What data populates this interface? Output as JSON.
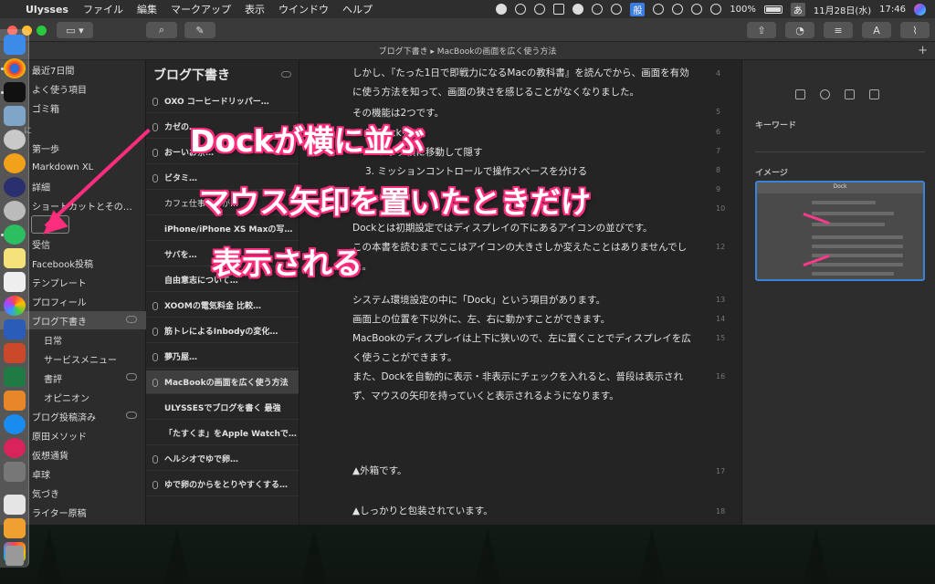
{
  "menubar": {
    "app_name": "Ulysses",
    "menus": [
      "ファイル",
      "編集",
      "マークアップ",
      "表示",
      "ウインドウ",
      "ヘルプ"
    ],
    "ime_kanji": "般",
    "battery": "100%",
    "ime_a": "あ",
    "date": "11月28日(水)",
    "time": "17:46"
  },
  "window": {
    "title": "ブログ下書き ▸ MacBookの画面を広く使う方法",
    "plus": "+"
  },
  "library": {
    "items": [
      {
        "label": "最近7日間"
      },
      {
        "label": "よく使う項目"
      },
      {
        "label": "ゴミ箱"
      },
      {
        "label": "に"
      },
      {
        "label": "第一歩"
      },
      {
        "label": "Markdown XL"
      },
      {
        "label": "詳細"
      },
      {
        "label": "ショートカットとその…"
      },
      {
        "label": "受信"
      },
      {
        "label": "Facebook投稿"
      },
      {
        "label": "テンプレート"
      },
      {
        "label": "プロフィール"
      },
      {
        "label": "ブログ下書き"
      },
      {
        "label": "日常"
      },
      {
        "label": "サービスメニュー"
      },
      {
        "label": "書評"
      },
      {
        "label": "オピニオン"
      },
      {
        "label": "ブログ投稿済み"
      },
      {
        "label": "原田メソッド"
      },
      {
        "label": "仮想通貨"
      },
      {
        "label": "卓球"
      },
      {
        "label": "気づき"
      },
      {
        "label": "ライター原稿"
      }
    ]
  },
  "sheets": {
    "title": "ブログ下書き",
    "items": [
      {
        "label": "OXO コーヒードリッパー…"
      },
      {
        "label": "カゼの…"
      },
      {
        "label": "おーいお茶…"
      },
      {
        "label": "ビタミ…"
      },
      {
        "label": "カフェ仕事で…が…"
      },
      {
        "label": "iPhone/iPhone XS Maxの写…"
      },
      {
        "label": "サバを…"
      },
      {
        "label": "自由意志について…"
      },
      {
        "label": "XOOMの電気料金 比較…"
      },
      {
        "label": "筋トレによるInbodyの変化…"
      },
      {
        "label": "夢乃屋…"
      },
      {
        "label": "MacBookの画面を広く使う方法"
      },
      {
        "label": "ULYSSESでブログを書く 最強"
      },
      {
        "label": "「たすくま」をApple Watchで…"
      },
      {
        "label": "ヘルシオでゆで卵…"
      },
      {
        "label": "ゆで卵のからをとりやすくする…"
      }
    ]
  },
  "editor": {
    "paragraphs": [
      {
        "text": "しかし、『たった1日で即戦力になるMacの教科書』を読んでから、画面を有効に使う方法を知って、画面の狭さを感じることがなくなりました。",
        "line": "4"
      },
      {
        "text": "その機能は2つです。",
        "line": "5"
      },
      {
        "text": "1. Dockを…",
        "line": "6"
      },
      {
        "text": "2. ドック横に移動して隠す",
        "line": "7"
      },
      {
        "text": "3. ミッションコントロールで操作スペースを分ける",
        "line": "8"
      },
      {
        "text": "",
        "line": "9"
      },
      {
        "text": "Dockとは初期設定ではディスプレイの下にあるアイコンの並びです。",
        "line": "10"
      },
      {
        "text": "この本書を読むまでここはアイコンの大きさしか変えたことはありませんでした。",
        "line": "12"
      },
      {
        "text": "システム環境設定の中に「Dock」という項目があります。",
        "line": "13"
      },
      {
        "text": "画面上の位置を下以外に、左、右に動かすことができます。",
        "line": "14"
      },
      {
        "text": "MacBookのディスプレイは上下に狭いので、左に置くことでディスプレイを広く使うことができます。",
        "line": "15"
      },
      {
        "text": "また、Dockを自動的に表示・非表示にチェックを入れると、普段は表示されず、マウスの矢印を持っていくと表示されるようになります。",
        "line": "16"
      },
      {
        "text": "▲外箱です。",
        "line": "17"
      },
      {
        "text": "▲しっかりと包装されています。",
        "line": "18"
      }
    ]
  },
  "attachments": {
    "keyword_label": "キーワード",
    "image_label": "イメージ",
    "thumb_title": "Dock"
  },
  "annotation": {
    "line1": "Dockが横に並ぶ",
    "line2": "マウス矢印を置いたときだけ",
    "line3": "表示される"
  },
  "colors": {
    "accent": "#ff2d7d",
    "selection": "#3a84d8"
  }
}
